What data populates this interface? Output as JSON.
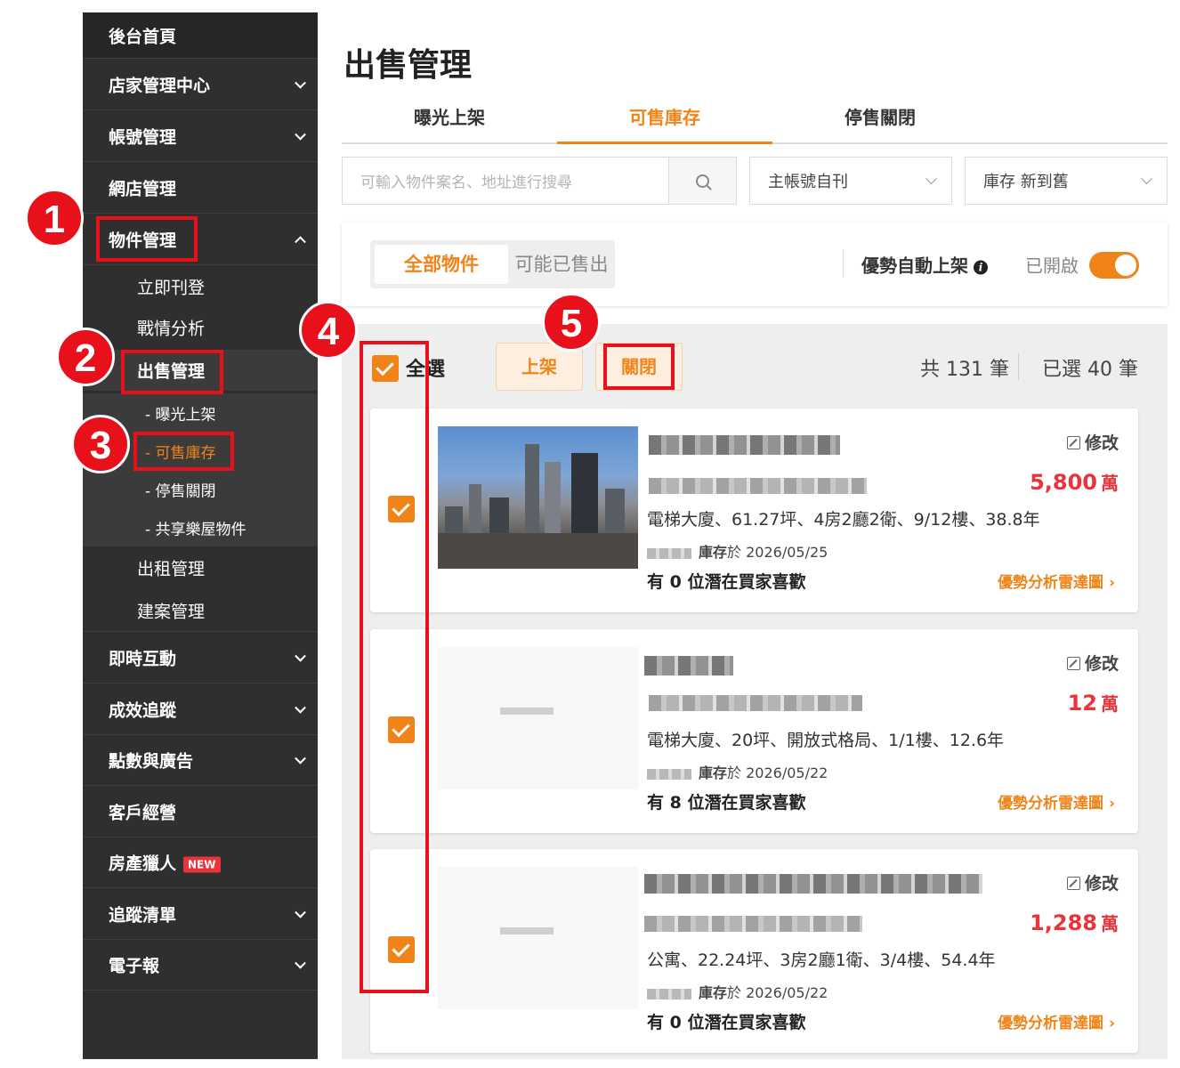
{
  "sidebar": {
    "home": "後台首頁",
    "items": [
      {
        "label": "店家管理中心"
      },
      {
        "label": "帳號管理"
      },
      {
        "label": "網店管理"
      },
      {
        "label": "物件管理"
      }
    ],
    "object_sub": [
      {
        "label": "立即刊登"
      },
      {
        "label": "戰情分析"
      },
      {
        "label": "出售管理"
      }
    ],
    "sale_sub": [
      {
        "label": "- 曝光上架"
      },
      {
        "label": "- 可售庫存"
      },
      {
        "label": "- 停售關閉"
      },
      {
        "label": "- 共享樂屋物件"
      }
    ],
    "object_sub2": [
      {
        "label": "出租管理"
      },
      {
        "label": "建案管理"
      }
    ],
    "bottom_items": [
      {
        "label": "即時互動"
      },
      {
        "label": "成效追蹤"
      },
      {
        "label": "點數與廣告"
      },
      {
        "label": "客戶經營"
      },
      {
        "label": "房產獵人",
        "badge": "NEW"
      },
      {
        "label": "追蹤清單"
      },
      {
        "label": "電子報"
      }
    ]
  },
  "main": {
    "title": "出售管理",
    "tabs": [
      {
        "label": "曝光上架"
      },
      {
        "label": "可售庫存"
      },
      {
        "label": "停售關閉"
      }
    ],
    "search": {
      "placeholder": "可輸入物件案名、地址進行搜尋"
    },
    "filter_account": "主帳號自刊",
    "filter_sort": "庫存 新到舊",
    "segments": [
      {
        "label": "全部物件"
      },
      {
        "label": "可能已售出"
      }
    ],
    "auto_listing_label": "優勢自動上架",
    "auto_listing_status": "已開啟",
    "select_all": "全選",
    "publish_button": "上架",
    "close_button": "關閉",
    "total_count": "共 131 筆",
    "selected_count": "已選 40 筆",
    "listings": [
      {
        "edit": "修改",
        "price": "5,800",
        "price_unit": "萬",
        "desc": "電梯大廈、61.27坪、4房2廳2衛、9/12樓、38.8年",
        "stock_label": "庫存",
        "stock_date": "於 2026/05/25",
        "buyers": "有 0 位潛在買家喜歡",
        "radar": "優勢分析雷達圖 ›"
      },
      {
        "edit": "修改",
        "price": "12",
        "price_unit": "萬",
        "desc": "電梯大廈、20坪、開放式格局、1/1樓、12.6年",
        "stock_label": "庫存",
        "stock_date": "於 2026/05/22",
        "buyers": "有 8 位潛在買家喜歡",
        "radar": "優勢分析雷達圖 ›"
      },
      {
        "edit": "修改",
        "price": "1,288",
        "price_unit": "萬",
        "desc": "公寓、22.24坪、3房2廳1衛、3/4樓、54.4年",
        "stock_label": "庫存",
        "stock_date": "於 2026/05/22",
        "buyers": "有 0 位潛在買家喜歡",
        "radar": "優勢分析雷達圖 ›"
      }
    ]
  },
  "annotations": [
    "1",
    "2",
    "3",
    "4",
    "5"
  ],
  "colors": {
    "accent": "#f08419",
    "sidebar": "#2f2f2f",
    "price": "#e8343a",
    "annotation": "#e8101a"
  }
}
